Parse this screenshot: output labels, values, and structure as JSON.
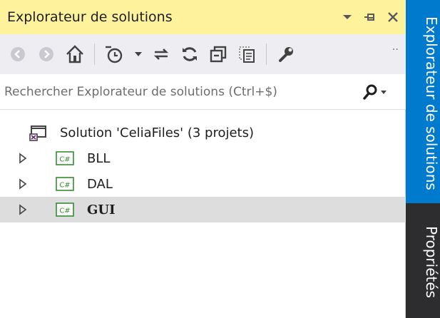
{
  "panel": {
    "title": "Explorateur de solutions"
  },
  "search": {
    "placeholder": "Rechercher Explorateur de solutions (Ctrl+$)"
  },
  "tree": {
    "solution_label": "Solution 'CeliaFiles' (3 projets)",
    "projects": [
      {
        "label": "BLL",
        "badge": "C#"
      },
      {
        "label": "DAL",
        "badge": "C#"
      },
      {
        "label": "GUI",
        "badge": "C#",
        "selected": true
      }
    ]
  },
  "sidebar": {
    "tabs": [
      {
        "label": "Explorateur de solutions",
        "active": true
      },
      {
        "label": "Propriétés",
        "active": false
      }
    ]
  },
  "colors": {
    "title_bg": "#fff29d",
    "toolbar_bg": "#eeeef2",
    "sidebar_bg": "#2d2d30",
    "active_tab": "#007acc",
    "csharp_green": "#388a34",
    "selected_row": "#dddddd"
  }
}
